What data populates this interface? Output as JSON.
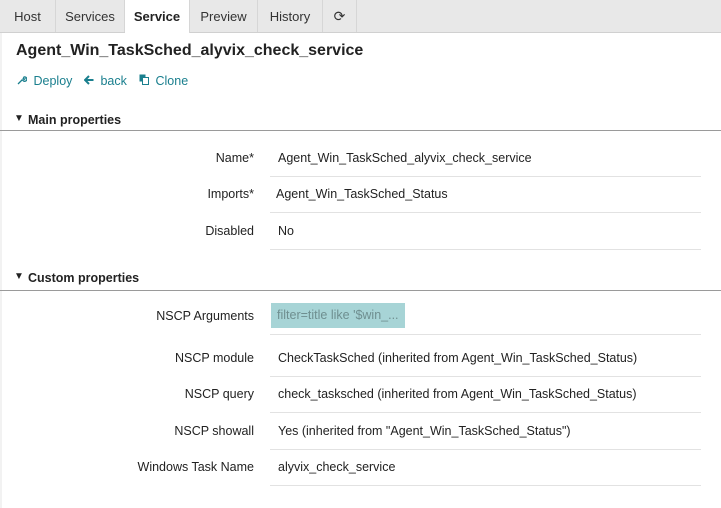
{
  "tabs": [
    {
      "label": "Host"
    },
    {
      "label": "Services"
    },
    {
      "label": "Service"
    },
    {
      "label": "Preview"
    },
    {
      "label": "History"
    }
  ],
  "refresh_icon": "⟳",
  "title": "Agent_Win_TaskSched_alyvix_check_service",
  "actions": {
    "deploy": "Deploy",
    "back": "back",
    "clone": "Clone"
  },
  "sections": {
    "main": "Main properties",
    "custom": "Custom properties"
  },
  "main_properties": [
    {
      "label": "Name*",
      "value": "Agent_Win_TaskSched_alyvix_check_service"
    },
    {
      "label": "Imports*",
      "value": "Agent_Win_TaskSched_Status"
    },
    {
      "label": "Disabled",
      "value": "No"
    }
  ],
  "custom_properties": [
    {
      "label": "NSCP Arguments",
      "value": "filter=title like '$win_..."
    },
    {
      "label": "NSCP module",
      "value": "CheckTaskSched (inherited from Agent_Win_TaskSched_Status)"
    },
    {
      "label": "NSCP query",
      "value": "check_tasksched (inherited from Agent_Win_TaskSched_Status)"
    },
    {
      "label": "NSCP showall",
      "value": "Yes (inherited from \"Agent_Win_TaskSched_Status\")"
    },
    {
      "label": "Windows Task Name",
      "value": "alyvix_check_service"
    }
  ],
  "colors": {
    "accent": "#1a7f8e",
    "shaded_value_bg": "#a7d4d6"
  }
}
